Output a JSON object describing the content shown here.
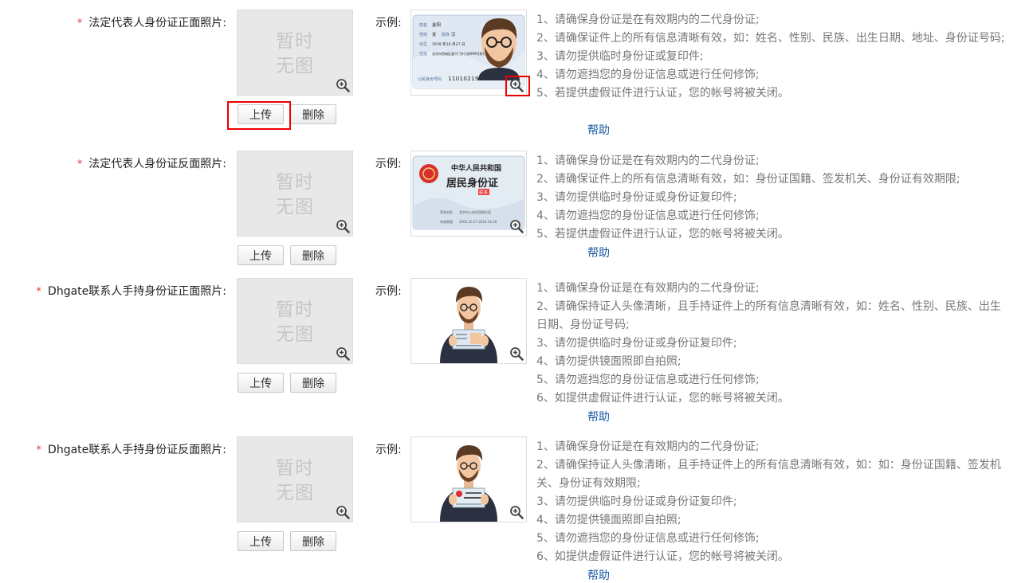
{
  "placeholder": "暂时\n无图",
  "example_label": "示例:",
  "upload_label": "上传",
  "delete_label": "删除",
  "help_label": "帮助",
  "sections": [
    {
      "label": "法定代表人身份证正面照片:",
      "notes": [
        "1、请确保身份证是在有效期内的二代身份证;",
        "2、请确保证件上的所有信息清晰有效，如：姓名、性别、民族、出生日期、地址、身份证号码;",
        "3、请勿提供临时身份证或复印件;",
        "4、请勿遮挡您的身份证信息或进行任何修饰;",
        "5、若提供虚假证件进行认证，您的帐号将被关闭。"
      ],
      "sample_text": {
        "name_label": "姓名",
        "name": "金阳",
        "sex_label": "性别",
        "sex": "女",
        "ethnic_label": "民族",
        "ethnic": "汉",
        "birth_label": "出生",
        "birth": "1978 年10 月27 日",
        "addr_label": "住址",
        "addr": "北京市西城区复兴门外大街999号院11号楼3单元502室",
        "id_label": "公民身份号码",
        "id": "110102197810272321"
      }
    },
    {
      "label": "法定代表人身份证反面照片:",
      "notes": [
        "1、请确保身份证是在有效期内的二代身份证;",
        "2、请确保证件上的所有信息清晰有效，如：身份证国籍、签发机关、身份证有效期限;",
        "3、请勿提供临时身份证或身份证复印件;",
        "4、请勿遮挡您的身份证信息或进行任何修饰;",
        "5、若提供虚假证件进行认证，您的帐号将被关闭。"
      ],
      "sample_text": {
        "country": "中华人民共和国",
        "title": "居民身份证",
        "stamp": "样本",
        "authority_label": "签发机关",
        "authority": "北京市公安局西城分局",
        "valid_label": "有效期限",
        "valid": "2004.10.27-2024.10.26"
      }
    },
    {
      "label": "Dhgate联系人手持身份证正面照片:",
      "notes": [
        "1、请确保身份证是在有效期内的二代身份证;",
        "2、请确保持证人头像清晰，且手持证件上的所有信息清晰有效，如：姓名、性别、民族、出生日期、身份证号码;",
        "3、请勿提供临时身份证或身份证复印件;",
        "4、请勿提供镜面照即自拍照;",
        "5、请勿遮挡您的身份证信息或进行任何修饰;",
        "6、如提供虚假证件进行认证，您的帐号将被关闭。"
      ]
    },
    {
      "label": "Dhgate联系人手持身份证反面照片:",
      "notes": [
        "1、请确保身份证是在有效期内的二代身份证;",
        "2、请确保持证人头像清晰，且手持证件上的所有信息清晰有效，如：如：身份证国籍、签发机关、身份证有效期限;",
        "3、请勿提供临时身份证或身份证复印件;",
        "4、请勿提供镜面照即自拍照;",
        "5、请勿遮挡您的身份证信息或进行任何修饰;",
        "6、如提供虚假证件进行认证，您的帐号将被关闭。"
      ]
    }
  ]
}
